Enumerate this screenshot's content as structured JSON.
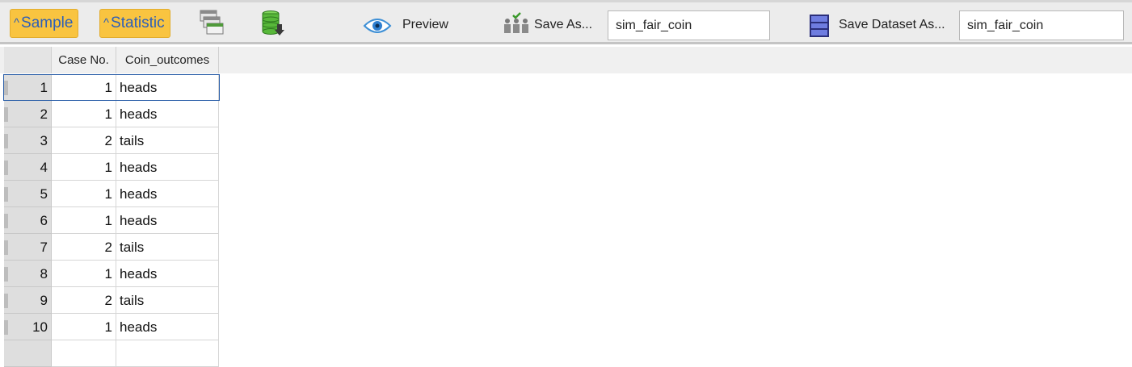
{
  "toolbar": {
    "sample_label": "Sample",
    "statistic_label": "Statistic",
    "preview_label": "Preview",
    "save_as_label": "Save As...",
    "save_as_value": "sim_fair_coin",
    "save_dataset_label": "Save Dataset As...",
    "save_dataset_value": "sim_fair_coin",
    "accent_color": "#f9c440",
    "icons": [
      "chevron-up-icon",
      "stacked-windows-icon",
      "database-download-icon",
      "eye-icon",
      "people-check-icon",
      "dataset-icon"
    ]
  },
  "table": {
    "columns": [
      "Case No.",
      "Coin_outcomes"
    ],
    "rows": [
      {
        "index": "1",
        "case": "1",
        "outcome": "heads"
      },
      {
        "index": "2",
        "case": "1",
        "outcome": "heads"
      },
      {
        "index": "3",
        "case": "2",
        "outcome": "tails"
      },
      {
        "index": "4",
        "case": "1",
        "outcome": "heads"
      },
      {
        "index": "5",
        "case": "1",
        "outcome": "heads"
      },
      {
        "index": "6",
        "case": "1",
        "outcome": "heads"
      },
      {
        "index": "7",
        "case": "2",
        "outcome": "tails"
      },
      {
        "index": "8",
        "case": "1",
        "outcome": "heads"
      },
      {
        "index": "9",
        "case": "2",
        "outcome": "tails"
      },
      {
        "index": "10",
        "case": "1",
        "outcome": "heads"
      }
    ],
    "selected_row": 1
  }
}
